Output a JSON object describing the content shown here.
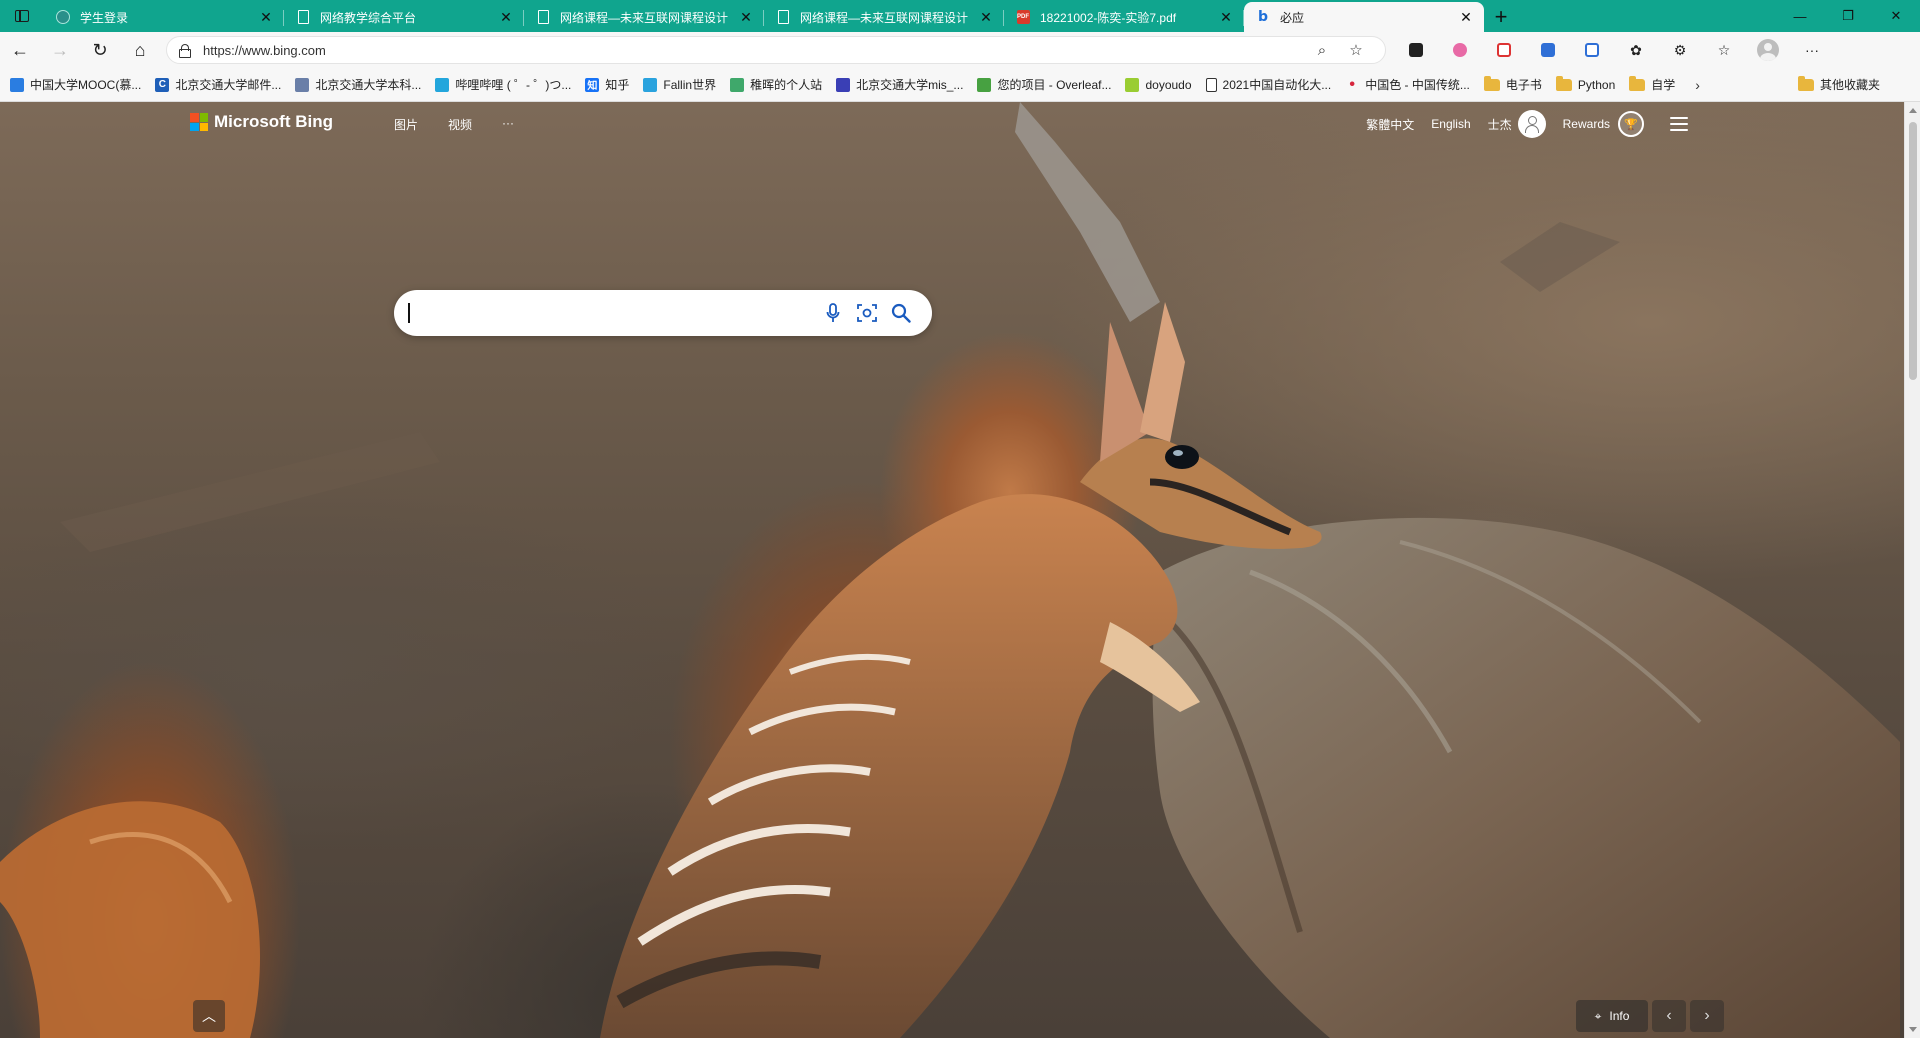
{
  "tabs": [
    {
      "title": "学生登录",
      "icon": "globe-icon",
      "active": false
    },
    {
      "title": "网络教学综合平台",
      "icon": "document-icon",
      "active": false
    },
    {
      "title": "网络课程—未来互联网课程设计",
      "icon": "document-icon",
      "active": false
    },
    {
      "title": "网络课程—未来互联网课程设计",
      "icon": "document-icon",
      "active": false
    },
    {
      "title": "18221002-陈奕-实验7.pdf",
      "icon": "pdf-icon",
      "pdf_label": "PDF",
      "active": false
    },
    {
      "title": "必应",
      "icon": "bing-icon",
      "active": true
    }
  ],
  "address_bar": {
    "url": "https://www.bing.com"
  },
  "favorites": [
    {
      "label": "中国大学MOOC(慕...",
      "icon": "mooc-icon",
      "color": "#2a7de1"
    },
    {
      "label": "北京交通大学邮件...",
      "icon": "c-icon",
      "letter": "C",
      "color": "#1f5fb8"
    },
    {
      "label": "北京交通大学本科...",
      "icon": "bjtu-icon",
      "color": "#6a7fa8"
    },
    {
      "label": "哔哩哔哩 ( ゜- ゜)つ...",
      "icon": "bilibili-icon",
      "color": "#23a6dc"
    },
    {
      "label": "知乎",
      "icon": "zhihu-icon",
      "letter": "知",
      "color": "#1772f6"
    },
    {
      "label": "Fallin世界",
      "icon": "telegram-icon",
      "color": "#2aa3de"
    },
    {
      "label": "稚晖的个人站",
      "icon": "site-icon",
      "color": "#3fa86b"
    },
    {
      "label": "北京交通大学mis_...",
      "icon": "paw-icon",
      "color": "#3a3fb5"
    },
    {
      "label": "您的项目 - Overleaf...",
      "icon": "overleaf-icon",
      "color": "#47a141"
    },
    {
      "label": "doyoudo",
      "icon": "leaf-icon",
      "color": "#9acd32"
    },
    {
      "label": "2021中国自动化大...",
      "icon": "document-icon",
      "color": "#ffffff"
    },
    {
      "label": "中国色 - 中国传统...",
      "icon": "dot-icon",
      "color": "#d7263d"
    },
    {
      "label": "电子书",
      "icon": "folder-icon",
      "color": "#e8b63d"
    },
    {
      "label": "Python",
      "icon": "folder-icon",
      "color": "#e8b63d"
    },
    {
      "label": "自学",
      "icon": "folder-icon",
      "color": "#e8b63d"
    }
  ],
  "favorites_other": "其他收藏夹",
  "bing": {
    "logo_text": "Microsoft Bing",
    "nav": [
      "图片",
      "视频"
    ],
    "more": "···",
    "right": {
      "trad_chinese": "繁體中文",
      "english": "English",
      "user_name": "士杰",
      "rewards": "Rewards"
    },
    "search_placeholder": "",
    "info_label": "Info"
  },
  "colors": {
    "tab_strip": "#10a58e",
    "bing_blue": "#1a5bbf",
    "ms_red": "#f25022",
    "ms_green": "#7fba00",
    "ms_blue": "#00a4ef",
    "ms_yellow": "#ffb900"
  }
}
